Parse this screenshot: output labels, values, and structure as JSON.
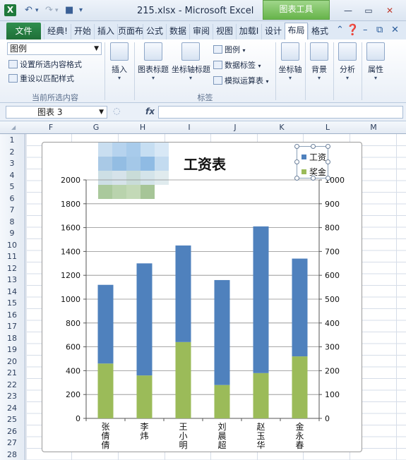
{
  "window": {
    "title": "215.xlsx - Microsoft Excel",
    "context_tab": "图表工具",
    "app_icon": "X"
  },
  "tabs": [
    "文件",
    "经典!",
    "开始",
    "插入",
    "页面布",
    "公式",
    "数据",
    "审阅",
    "视图",
    "加载I",
    "设计",
    "布局",
    "格式"
  ],
  "active_tab": "布局",
  "ribbon": {
    "selection_dropdown": "图例",
    "format_selection": "设置所选内容格式",
    "reset_style": "重设以匹配样式",
    "group_current": "当前所选内容",
    "insert": "插入",
    "chart_title": "图表标题",
    "axis_titles": "坐标轴标题",
    "legend": "图例",
    "data_labels": "数据标签",
    "data_table": "模拟运算表",
    "group_labels": "标签",
    "axes": "坐标轴",
    "background": "背景",
    "analysis": "分析",
    "properties": "属性"
  },
  "formula_bar": {
    "name_box": "图表 3",
    "fx": "fx",
    "formula": ""
  },
  "columns": [
    "F",
    "G",
    "H",
    "I",
    "J",
    "K",
    "L",
    "M"
  ],
  "rows": [
    "1",
    "2",
    "3",
    "4",
    "5",
    "6",
    "7",
    "8",
    "9",
    "10",
    "11",
    "12",
    "13",
    "14",
    "15",
    "16",
    "17",
    "18",
    "19",
    "20",
    "21",
    "22",
    "23",
    "24",
    "25",
    "26",
    "27",
    "28"
  ],
  "chart_data": {
    "type": "bar",
    "stacked": true,
    "title": "工资表",
    "categories": [
      "张倩倩",
      "李炜",
      "王小明",
      "刘晨超",
      "赵玉华",
      "金永春"
    ],
    "category_label_lines": [
      [
        "张",
        "倩",
        "倩"
      ],
      [
        "李",
        "炜"
      ],
      [
        "王",
        "小",
        "明"
      ],
      [
        "刘",
        "晨",
        "超"
      ],
      [
        "赵",
        "玉",
        "华"
      ],
      [
        "金",
        "永",
        "春"
      ]
    ],
    "series": [
      {
        "name": "奖金",
        "values": [
          460,
          360,
          640,
          280,
          380,
          520
        ],
        "color": "#9bbb59",
        "axis": "left"
      },
      {
        "name": "工资",
        "values": [
          660,
          940,
          810,
          880,
          1230,
          820
        ],
        "color": "#4f81bd",
        "axis": "left"
      }
    ],
    "legend_order": [
      "工资",
      "奖金"
    ],
    "y_left": {
      "min": 0,
      "max": 2000,
      "ticks": [
        0,
        200,
        400,
        600,
        800,
        1000,
        1200,
        1400,
        1600,
        1800,
        2000
      ]
    },
    "y_right": {
      "min": 0,
      "max": 1000,
      "ticks": [
        0,
        100,
        200,
        300,
        400,
        500,
        600,
        700,
        800,
        900,
        1000
      ]
    },
    "grid": true,
    "legend_position": "top-right"
  }
}
